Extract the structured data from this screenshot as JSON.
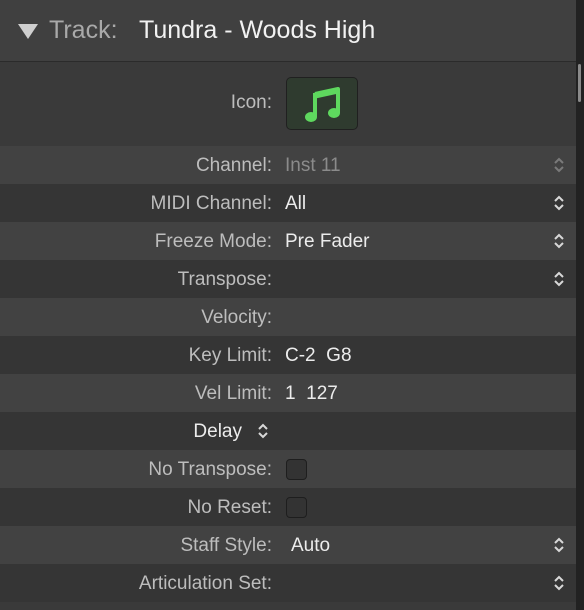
{
  "header": {
    "prefix": "Track:",
    "name": "Tundra - Woods High"
  },
  "icon_row": {
    "label": "Icon:",
    "icon": "music-notes-icon",
    "icon_color": "#5ed85e"
  },
  "rows": {
    "channel": {
      "label": "Channel:",
      "value": "Inst 11"
    },
    "midi_channel": {
      "label": "MIDI Channel:",
      "value": "All"
    },
    "freeze_mode": {
      "label": "Freeze Mode:",
      "value": "Pre Fader"
    },
    "transpose": {
      "label": "Transpose:",
      "value": ""
    },
    "velocity": {
      "label": "Velocity:",
      "value": ""
    },
    "key_limit": {
      "label": "Key Limit:",
      "value": "C-2  G8"
    },
    "vel_limit": {
      "label": "Vel Limit:",
      "value": "1  127"
    },
    "delay": {
      "label": "Delay"
    },
    "no_transpose": {
      "label": "No Transpose:",
      "checked": false
    },
    "no_reset": {
      "label": "No Reset:",
      "checked": false
    },
    "staff_style": {
      "label": "Staff Style:",
      "value": "Auto"
    },
    "articulation_set": {
      "label": "Articulation Set:",
      "value": ""
    }
  }
}
